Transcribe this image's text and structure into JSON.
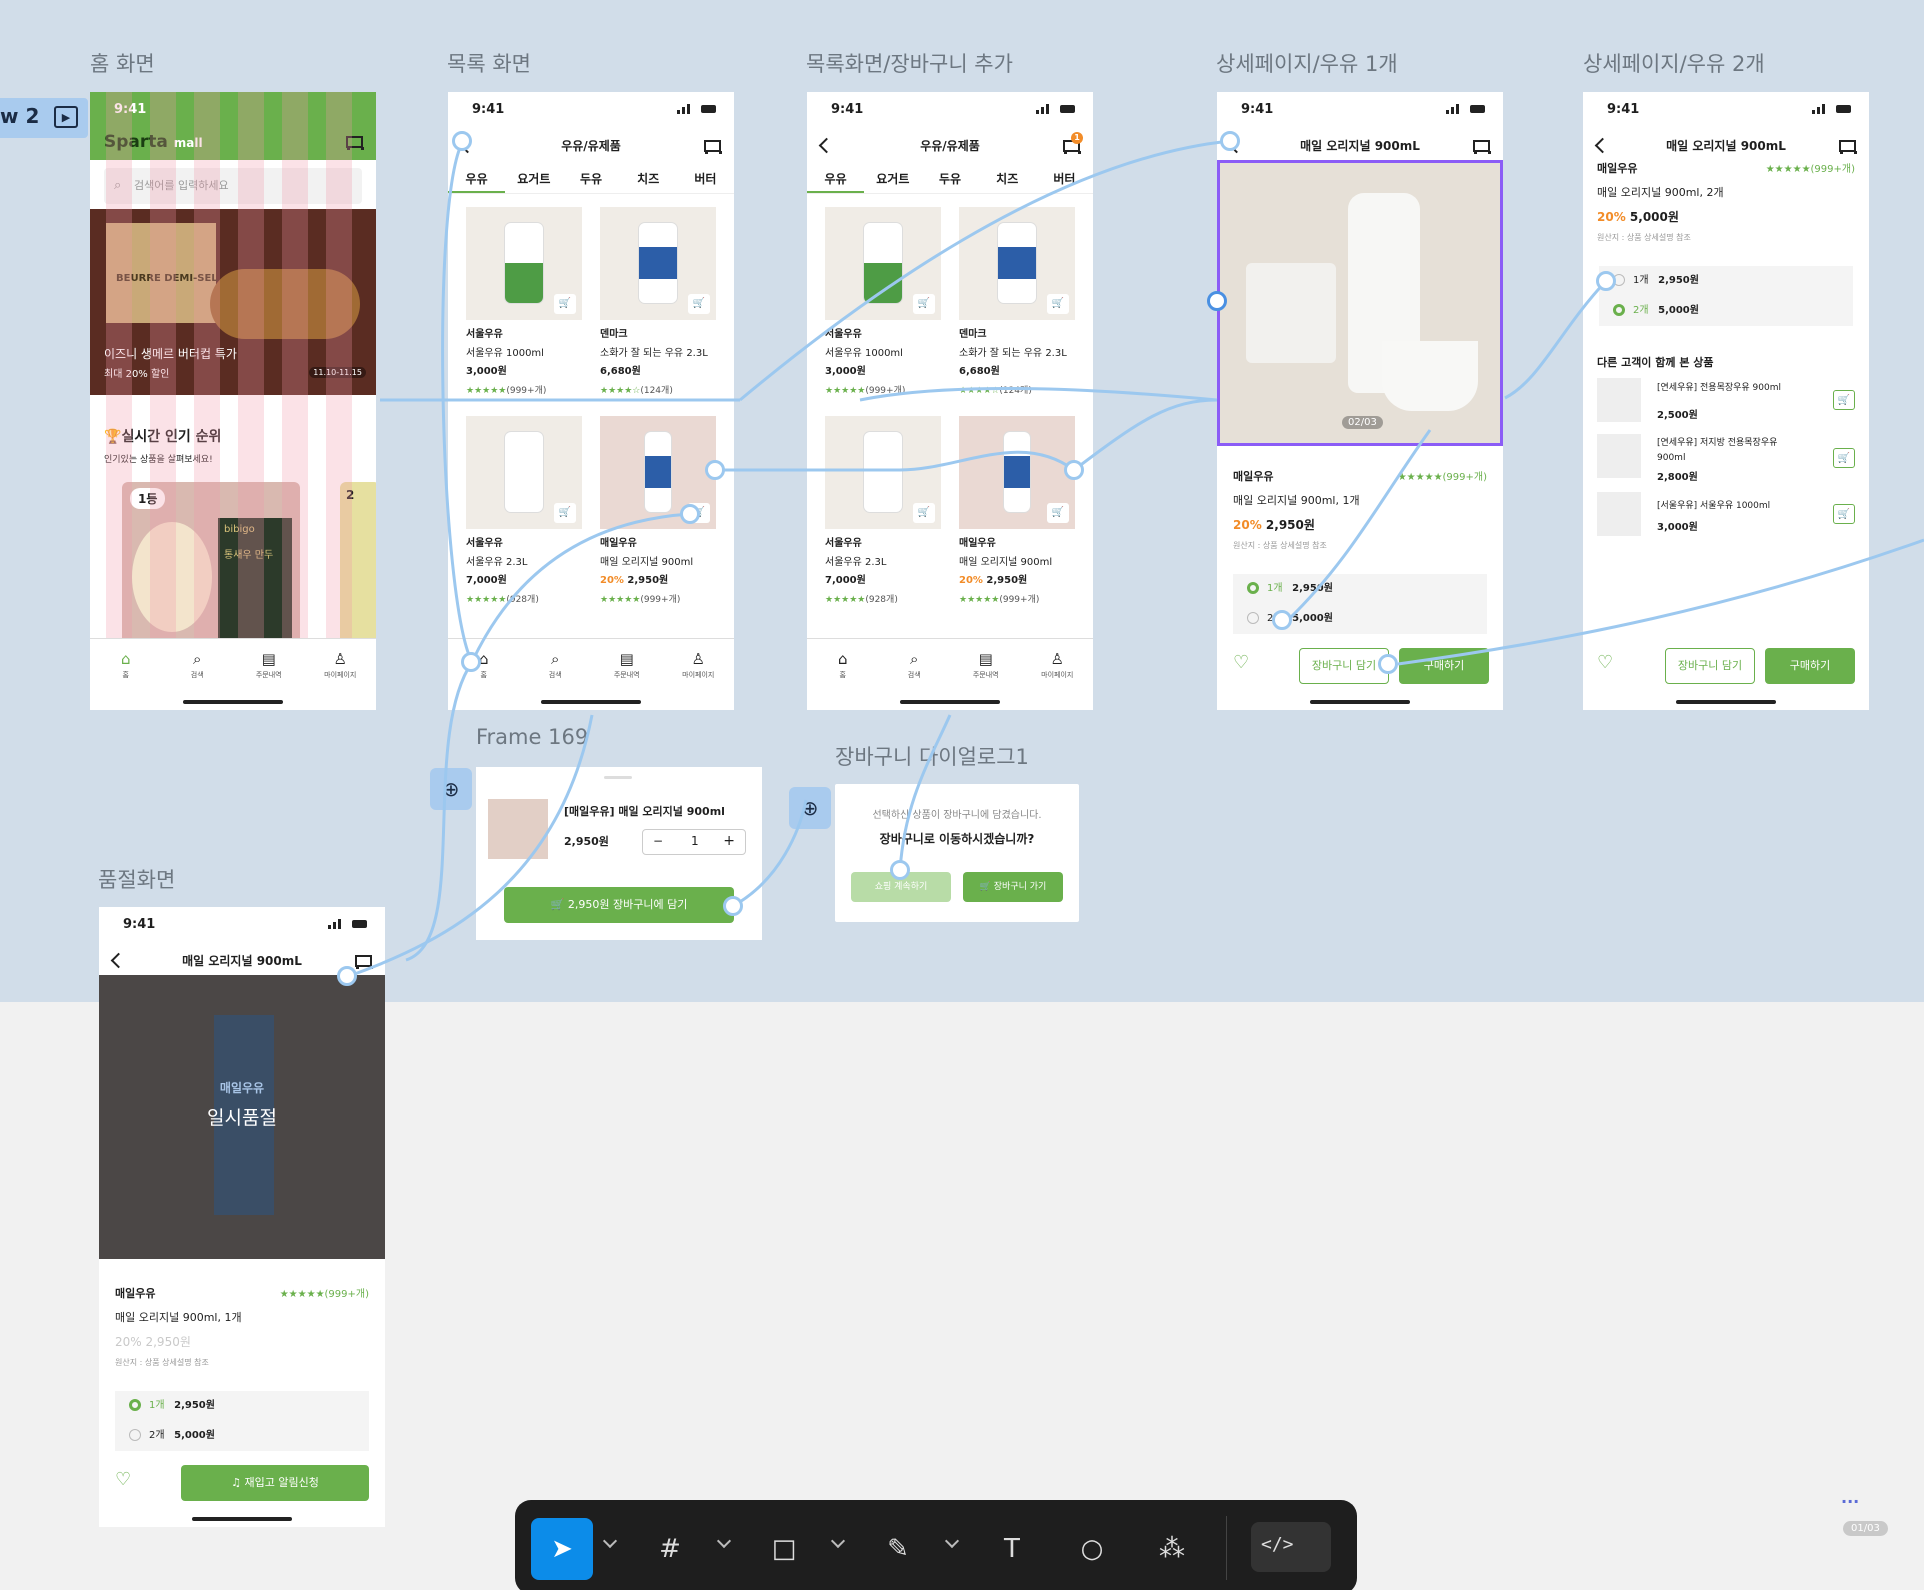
{
  "frames": {
    "home": {
      "label": "홈 화면",
      "status_time": "9:41",
      "logo": "Sparta",
      "logo_sub": "mall",
      "search_placeholder": "검색어를 입력하세요",
      "banner_title": "이즈니 생메르 버터컵 특가",
      "banner_sub": "최대 20% 할인",
      "banner_date": "11.10-11.15",
      "banner_text": "BEURRE DEMI-SEL",
      "rank_title": "실시간 인기 순위",
      "rank_sub": "인기있는 상품을 살펴보세요!",
      "rank1": "1등",
      "rank2": "2",
      "rank_pack": "bibigo",
      "rank_pack2": "통새우 만두"
    },
    "list": {
      "label": "목록 화면",
      "status_time": "9:41",
      "title": "우유/유제품"
    },
    "list_cart": {
      "label": "목록화면/장바구니 추가",
      "status_time": "9:41",
      "title": "우유/유제품",
      "cart_badge": "1"
    },
    "detail1": {
      "label": "상세페이지/우유 1개",
      "status_time": "9:41",
      "title": "매일 오리지널 900mL",
      "image_counter": "02/03",
      "brand": "매일우유",
      "rating": "★★★★★(999+개)",
      "name": "매일 오리지널 900ml, 1개",
      "discount": "20%",
      "price": "2,950원",
      "origin": "원산지 : 상품 상세설명 참조",
      "opt1_qty": "1개",
      "opt1_price": "2,950원",
      "opt2_qty": "2개",
      "opt2_price": "5,000원",
      "btn_cart": "장바구니 담기",
      "btn_buy": "구매하기"
    },
    "detail2": {
      "label": "상세페이지/우유 2개",
      "status_time": "9:41",
      "title": "매일 오리지널 900mL",
      "brand": "매일우유",
      "rating": "★★★★★(999+개)",
      "name": "매일 오리지널 900ml, 2개",
      "discount": "20%",
      "price": "5,000원",
      "origin": "원산지 : 상품 상세설명 참조",
      "opt1_qty": "1개",
      "opt1_price": "2,950원",
      "opt2_qty": "2개",
      "opt2_price": "5,000원",
      "section": "다른 고객이 함께 본 상품",
      "related": [
        {
          "name": "[연세우유] 전용목장우유 900ml",
          "price": "2,500원"
        },
        {
          "name": "[연세우유] 저지방 전용목장우유 900ml",
          "price": "2,800원"
        },
        {
          "name": "[서울우유] 서울우유 1000ml",
          "price": "3,000원"
        }
      ],
      "btn_cart": "장바구니 담기",
      "btn_buy": "구매하기"
    },
    "soldout": {
      "label": "품절화면",
      "status_time": "9:41",
      "title": "매일 오리지널 900mL",
      "overlay": "일시품절",
      "pack_text": "매일우유",
      "brand": "매일우유",
      "rating": "★★★★★(999+개)",
      "name": "매일 오리지널 900ml, 1개",
      "price_dim": "20% 2,950원",
      "origin": "원산지 : 상품 상세설명 참조",
      "opt1_qty": "1개",
      "opt1_price": "2,950원",
      "opt2_qty": "2개",
      "opt2_price": "5,000원",
      "btn": "재입고 알림신청"
    },
    "frame169": {
      "label": "Frame 169",
      "product": "[매일우유] 매일 오리지널 900ml",
      "price": "2,950원",
      "qty": "1",
      "minus": "−",
      "plus": "+",
      "btn": "2,950원 장바구니에 담기"
    },
    "dialog": {
      "label": "장바구니 다이얼로그1",
      "line1": "선택하신 상품이 장바구니에 담겼습니다.",
      "line2": "장바구니로 이동하시겠습니까?",
      "btn_continue": "쇼핑 계속하기",
      "btn_go": "장바구니 가기"
    }
  },
  "products": [
    {
      "brand": "서울우유",
      "name": "서울우유 1000ml",
      "price": "3,000원",
      "rating": "★★★★★",
      "reviews": "(999+개)",
      "discount": ""
    },
    {
      "brand": "덴마크",
      "name": "소화가 잘 되는 우유 2.3L",
      "price": "6,680원",
      "rating": "★★★★☆",
      "reviews": "(124개)",
      "discount": ""
    },
    {
      "brand": "서울우유",
      "name": "서울우유 2.3L",
      "price": "7,000원",
      "rating": "★★★★★",
      "reviews": "(928개)",
      "discount": ""
    },
    {
      "brand": "매일우유",
      "name": "매일 오리지널 900ml",
      "price": "2,950원",
      "rating": "★★★★★",
      "reviews": "(999+개)",
      "discount": "20%"
    }
  ],
  "tabs": [
    "우유",
    "요거트",
    "두유",
    "치즈",
    "버터"
  ],
  "nav": [
    "홈",
    "검색",
    "주문내역",
    "마이페이지"
  ],
  "side_tag": "w 2",
  "page_indicator": "01/03",
  "more": "...",
  "colors": {
    "canvas": "#d1dde9",
    "accent": "#6ab04c",
    "connector": "#9cc8ef",
    "selection": "#8b5cf6",
    "toolbar": "#1e1e1e",
    "active_tool": "#0c8ce9"
  },
  "toolbar": {
    "tools": [
      "move-tool",
      "frame-tool",
      "shape-tool",
      "pen-tool",
      "text-tool",
      "comment-tool",
      "components-tool",
      "dev-mode-toggle"
    ]
  }
}
